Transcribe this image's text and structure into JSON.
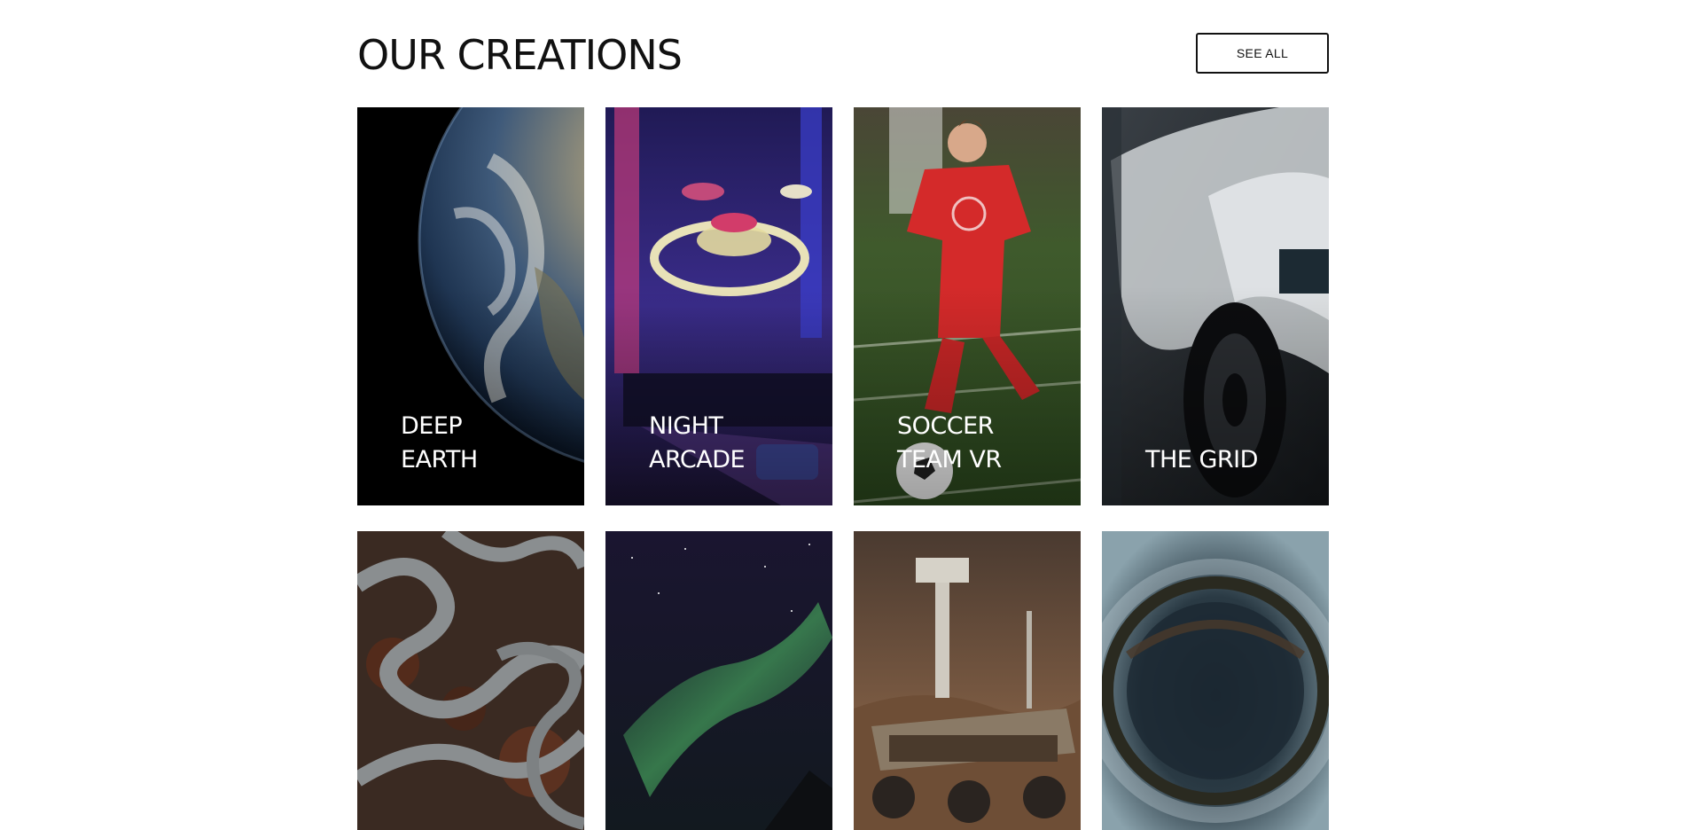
{
  "section": {
    "title": "OUR CREATIONS",
    "see_all_label": "SEE ALL"
  },
  "cards": [
    {
      "title_line1": "DEEP",
      "title_line2": "EARTH",
      "image": "earth-from-space"
    },
    {
      "title_line1": "NIGHT",
      "title_line2": "ARCADE",
      "image": "skee-ball-arcade"
    },
    {
      "title_line1": "SOCCER",
      "title_line2": "TEAM VR",
      "image": "soccer-player"
    },
    {
      "title_line1": "",
      "title_line2": "THE GRID",
      "image": "race-car"
    },
    {
      "image": "winding-roads-aerial"
    },
    {
      "image": "aurora-borealis"
    },
    {
      "image": "mars-rover"
    },
    {
      "image": "tiny-planet"
    }
  ],
  "colors": {
    "text": "#111111",
    "background": "#ffffff",
    "card_text": "#ffffff"
  }
}
